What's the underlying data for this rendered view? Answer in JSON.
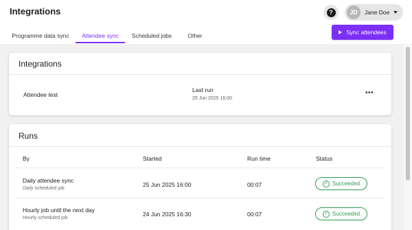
{
  "header": {
    "title": "Integrations",
    "help_glyph": "?",
    "user": {
      "initials": "JD",
      "name": "Jane Doe"
    }
  },
  "tabs": [
    {
      "label": "Programme data sync",
      "active": false
    },
    {
      "label": "Attendee sync",
      "active": true
    },
    {
      "label": "Scheduled jobs",
      "active": false
    },
    {
      "label": "Other",
      "active": false
    }
  ],
  "actions": {
    "sync_label": "Sync attendees"
  },
  "integrations_card": {
    "title": "Integrations",
    "item": {
      "name": "Attendee test",
      "last_run_label": "Last run",
      "last_run_value": "25 Jun 2025 16:00"
    }
  },
  "runs_card": {
    "title": "Runs",
    "columns": {
      "by": "By",
      "started": "Started",
      "run_time": "Run time",
      "status": "Status"
    },
    "rows": [
      {
        "name": "Daily attendee sync",
        "type": "Daily scheduled job",
        "started": "25 Jun 2025 16:00",
        "run_time": "00:07",
        "status": "Succeeded"
      },
      {
        "name": "Hourly job until the next day",
        "type": "Hourly scheduled job",
        "started": "24 Jun 2025 16:30",
        "run_time": "00:07",
        "status": "Succeeded"
      }
    ]
  },
  "colors": {
    "accent": "#7b2ff7",
    "success": "#2e9a4f",
    "background": "#f1f1f1"
  },
  "icons": {
    "help": "help-circle-icon",
    "more": "more-horizontal-icon",
    "play": "play-icon",
    "success": "check-circle-icon",
    "dropdown": "chevron-down-icon"
  }
}
